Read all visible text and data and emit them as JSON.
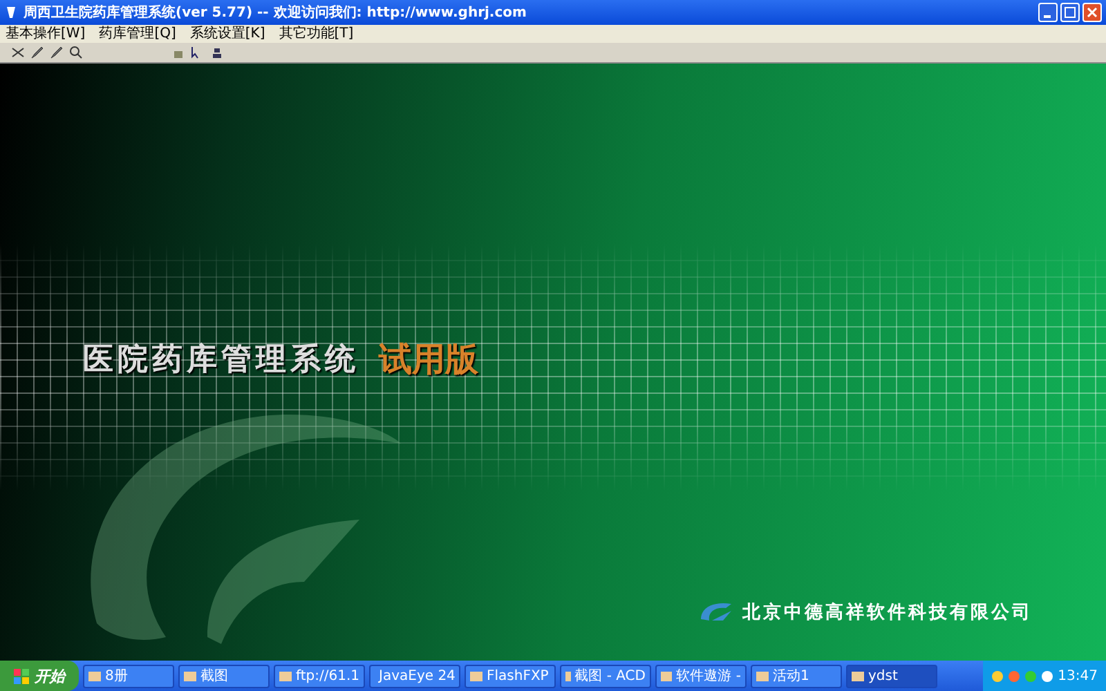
{
  "window": {
    "title": "周西卫生院药库管理系统(ver 5.77) -- 欢迎访问我们: http://www.ghrj.com"
  },
  "menu": [
    "基本操作[W]",
    "药库管理[Q]",
    "系统设置[K]",
    "其它功能[T]"
  ],
  "splash": {
    "title": "医院药库管理系统",
    "edition": "试用版",
    "company": "北京中德高祥软件科技有限公司"
  },
  "taskbar": {
    "start": "开始",
    "items": [
      {
        "label": "8册",
        "selected": false
      },
      {
        "label": "截图",
        "selected": false
      },
      {
        "label": "ftp://61.1",
        "selected": false
      },
      {
        "label": "JavaEye 24",
        "selected": false
      },
      {
        "label": "FlashFXP",
        "selected": false
      },
      {
        "label": "截图 - ACD",
        "selected": false
      },
      {
        "label": "软件遨游 -",
        "selected": false
      },
      {
        "label": "活动1",
        "selected": false
      },
      {
        "label": "ydst",
        "selected": true
      }
    ],
    "clock": "13:47"
  }
}
